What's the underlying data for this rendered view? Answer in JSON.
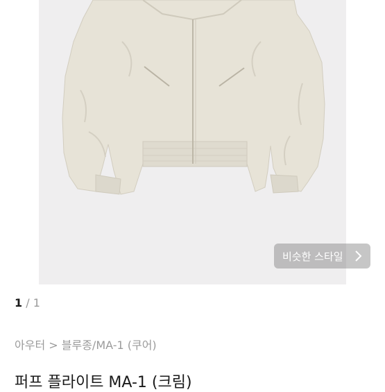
{
  "product_image": {
    "alt": "퍼프 플라이트 MA-1 (크림)",
    "color": "#e8e4d8"
  },
  "similar_style_button": {
    "label": "비슷한 스타일",
    "icon": "chevron-right-icon"
  },
  "image_counter": {
    "current": "1",
    "separator": "/",
    "total": "1"
  },
  "breadcrumb": {
    "category": "아우터",
    "separator": ">",
    "subcategory": "블루종/MA-1 (쿠어)"
  },
  "product": {
    "title": "퍼프 플라이트 MA-1 (크림)"
  }
}
